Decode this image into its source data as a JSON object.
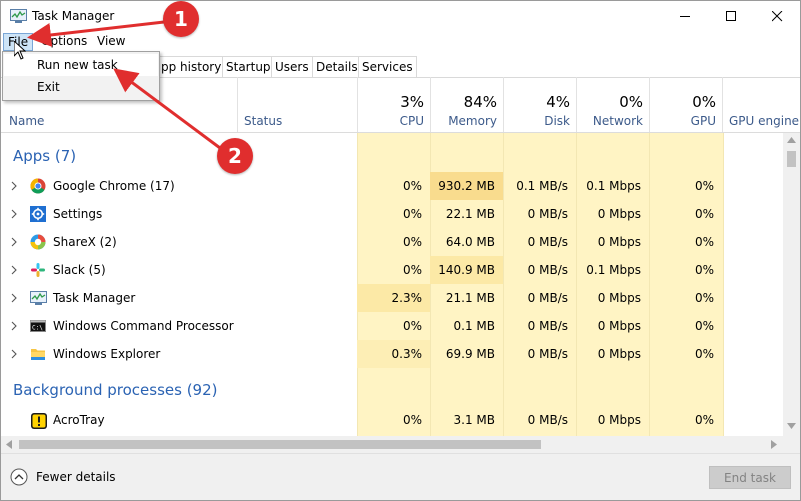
{
  "window": {
    "title": "Task Manager"
  },
  "menu": {
    "file": "File",
    "options": "Options",
    "view": "View"
  },
  "file_menu": {
    "items": [
      "Run new task",
      "Exit"
    ]
  },
  "tabs": [
    "pp history",
    "Startup",
    "Users",
    "Details",
    "Services"
  ],
  "columns": {
    "name": "Name",
    "status": "Status",
    "cpu": {
      "pct": "3%",
      "label": "CPU"
    },
    "memory": {
      "pct": "84%",
      "label": "Memory"
    },
    "disk": {
      "pct": "4%",
      "label": "Disk"
    },
    "network": {
      "pct": "0%",
      "label": "Network"
    },
    "gpu": {
      "pct": "0%",
      "label": "GPU"
    },
    "gpu_engine": "GPU engine"
  },
  "groups": {
    "apps": "Apps (7)",
    "background": "Background processes (92)"
  },
  "apps": [
    {
      "name": "Google Chrome (17)",
      "icon": "chrome-icon",
      "cpu": "0%",
      "memory": "930.2 MB",
      "disk": "0.1 MB/s",
      "network": "0.1 Mbps",
      "gpu": "0%"
    },
    {
      "name": "Settings",
      "icon": "gear-icon",
      "cpu": "0%",
      "memory": "22.1 MB",
      "disk": "0 MB/s",
      "network": "0 Mbps",
      "gpu": "0%"
    },
    {
      "name": "ShareX (2)",
      "icon": "sharex-icon",
      "cpu": "0%",
      "memory": "64.0 MB",
      "disk": "0 MB/s",
      "network": "0 Mbps",
      "gpu": "0%"
    },
    {
      "name": "Slack (5)",
      "icon": "slack-icon",
      "cpu": "0%",
      "memory": "140.9 MB",
      "disk": "0 MB/s",
      "network": "0.1 Mbps",
      "gpu": "0%"
    },
    {
      "name": "Task Manager",
      "icon": "task-manager-icon",
      "cpu": "2.3%",
      "memory": "21.1 MB",
      "disk": "0 MB/s",
      "network": "0 Mbps",
      "gpu": "0%"
    },
    {
      "name": "Windows Command Processor",
      "icon": "cmd-icon",
      "cpu": "0%",
      "memory": "0.1 MB",
      "disk": "0 MB/s",
      "network": "0 Mbps",
      "gpu": "0%"
    },
    {
      "name": "Windows Explorer",
      "icon": "folder-icon",
      "cpu": "0.3%",
      "memory": "69.9 MB",
      "disk": "0 MB/s",
      "network": "0 Mbps",
      "gpu": "0%"
    }
  ],
  "background": [
    {
      "name": "AcroTray",
      "icon": "acrotray-icon",
      "cpu": "0%",
      "memory": "3.1 MB",
      "disk": "0 MB/s",
      "network": "0 Mbps",
      "gpu": "0%"
    }
  ],
  "footer": {
    "fewer_details": "Fewer details",
    "end_task": "End task"
  },
  "annotations": {
    "badge1": "1",
    "badge2": "2"
  },
  "colors": {
    "heat_light": "#fff4c4",
    "heat_medium": "#fce9a6",
    "heat_strong": "#f9dc8e",
    "group_blue": "#2b63b3",
    "badge_red": "#e02e2e"
  }
}
